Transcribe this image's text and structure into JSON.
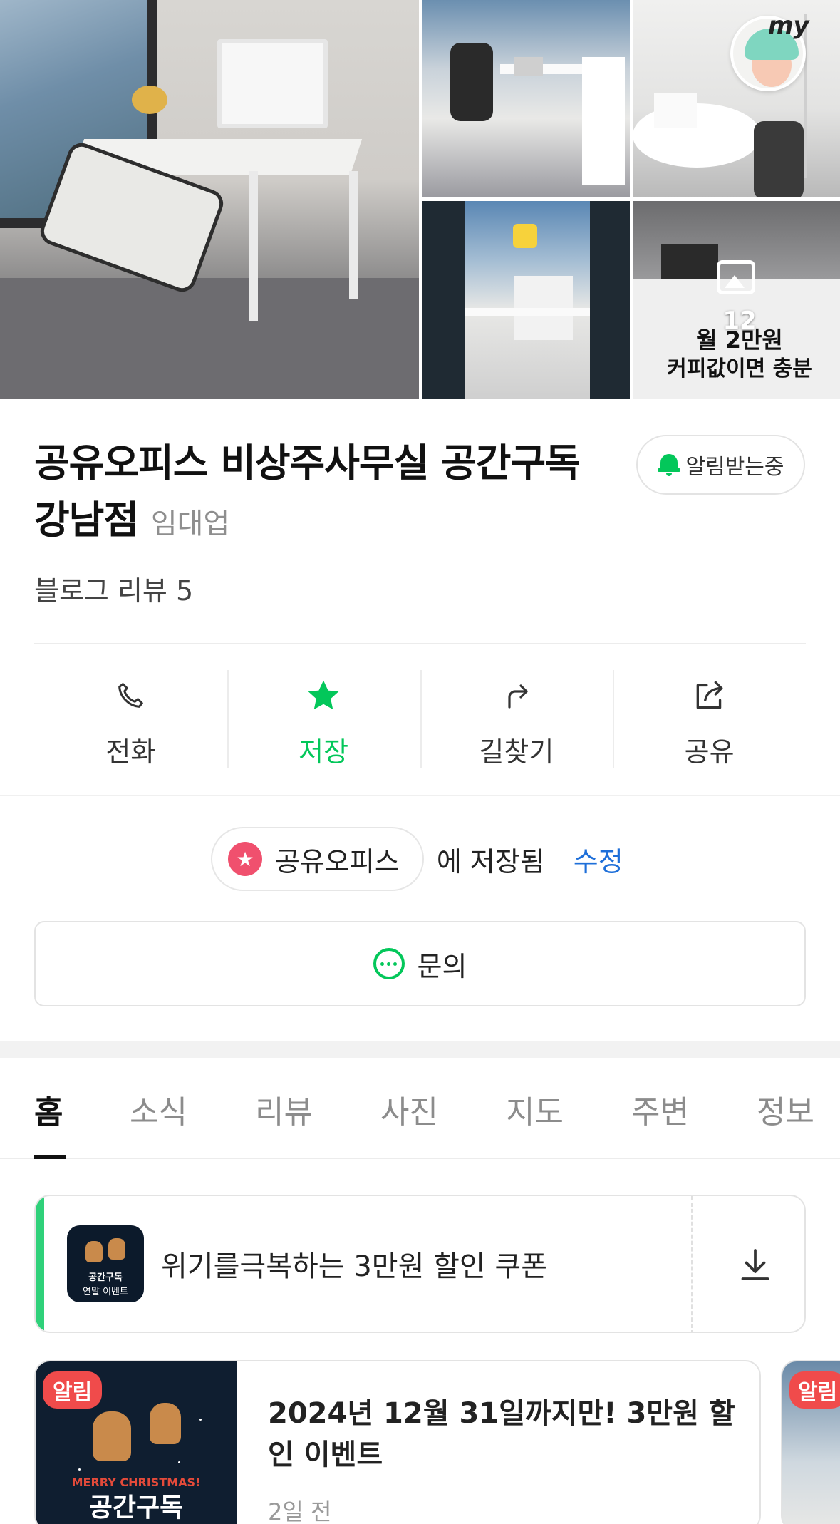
{
  "photos": {
    "overlay_count": "12",
    "ad_line1": "월 2만원",
    "ad_line2": "커피값이면 충분",
    "my_badge": "my"
  },
  "place": {
    "name_line1": "공유오피스 비상주사무실 공간구독",
    "name_line2": "강남점",
    "category": "임대업",
    "review_summary": "블로그 리뷰 5",
    "notify_label": "알림받는중"
  },
  "actions": [
    {
      "label": "전화",
      "icon": "phone-icon"
    },
    {
      "label": "저장",
      "icon": "star-icon"
    },
    {
      "label": "길찾기",
      "icon": "directions-icon"
    },
    {
      "label": "공유",
      "icon": "share-icon"
    }
  ],
  "saved": {
    "list_name": "공유오피스",
    "saved_text": "에 저장됨",
    "edit_label": "수정"
  },
  "inquiry_label": "문의",
  "tabs": [
    "홈",
    "소식",
    "리뷰",
    "사진",
    "지도",
    "주변",
    "정보"
  ],
  "coupon": {
    "text": "위기를극복하는 3만원 할인 쿠폰",
    "thumb_line1": "공간구독",
    "thumb_line2": "연말 이벤트"
  },
  "news": {
    "badge": "알림",
    "title": "2024년 12월 31일까지만! 3만원 할인 이벤트",
    "time": "2일 전",
    "image_line1": "MERRY CHRISTMAS!",
    "image_line2": "공간구독"
  },
  "colors": {
    "accent_green": "#03c75a",
    "link_blue": "#1e6fd9",
    "badge_red": "#f04b4b"
  }
}
